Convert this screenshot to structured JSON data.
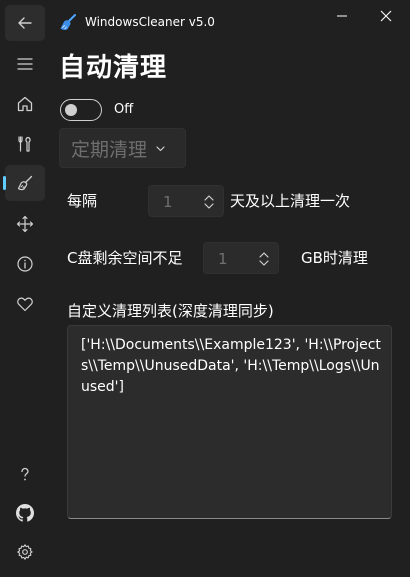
{
  "app": {
    "title": "WindowsCleaner v5.0"
  },
  "nav": {
    "items": [
      {
        "name": "back-button",
        "icon": "back-arrow-icon"
      },
      {
        "name": "menu-button",
        "icon": "hamburger-icon"
      },
      {
        "name": "nav-home",
        "icon": "home-icon"
      },
      {
        "name": "nav-tools",
        "icon": "tools-icon"
      },
      {
        "name": "nav-auto-clean",
        "icon": "broom-icon",
        "active": true
      },
      {
        "name": "nav-move",
        "icon": "move-arrows-icon"
      },
      {
        "name": "nav-info",
        "icon": "info-icon"
      },
      {
        "name": "nav-favorites",
        "icon": "heart-icon"
      },
      {
        "name": "nav-help",
        "icon": "question-icon"
      },
      {
        "name": "nav-github",
        "icon": "github-icon"
      },
      {
        "name": "nav-settings",
        "icon": "gear-icon"
      }
    ]
  },
  "page": {
    "title": "自动清理",
    "toggle": {
      "state_label": "Off",
      "checked": false
    },
    "mode_select": {
      "selected": "定期清理",
      "enabled": false
    },
    "interval": {
      "label": "每隔",
      "value": "1",
      "suffix": "天及以上清理一次"
    },
    "space": {
      "label": "C盘剩余空间不足",
      "value": "1",
      "suffix": "GB时清理"
    },
    "custom_list": {
      "label": "自定义清理列表(深度清理同步)",
      "value": "['H:\\\\Documents\\\\Example123', 'H:\\\\Projects\\\\Temp\\\\UnusedData', 'H:\\\\Temp\\\\Logs\\\\Unused']"
    }
  },
  "colors": {
    "background": "#202020",
    "accent": "#60cdff",
    "disabled_text": "#6e6e6e"
  }
}
